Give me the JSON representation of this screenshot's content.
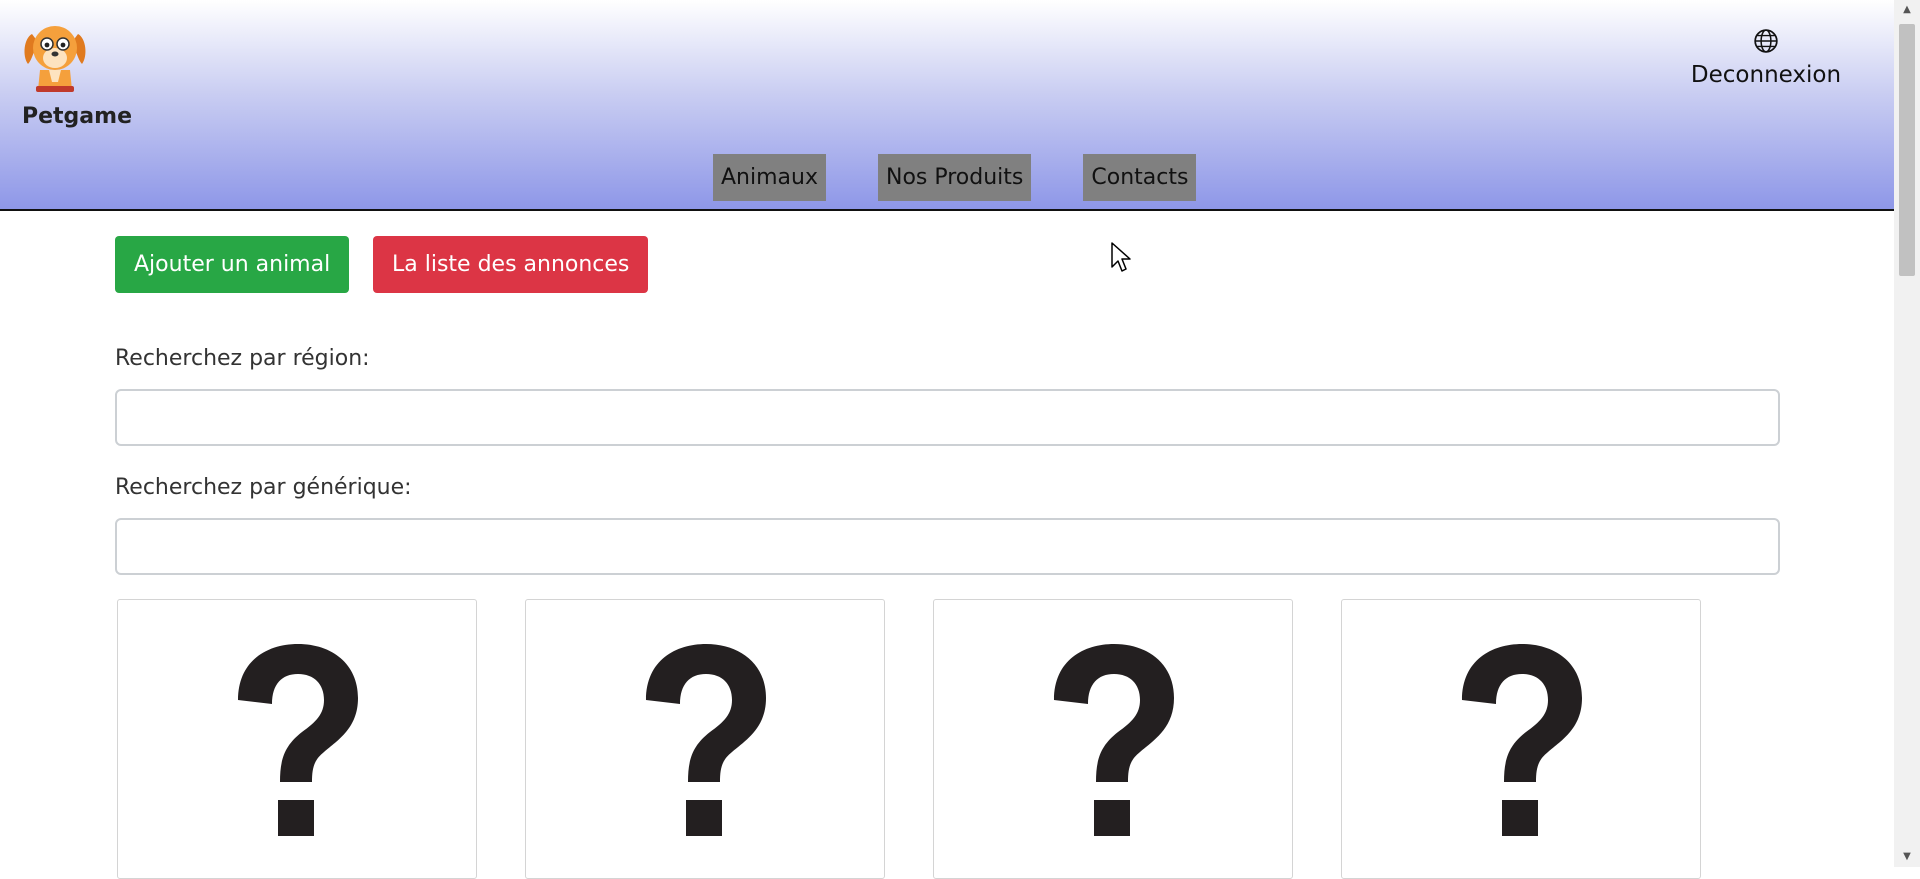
{
  "header": {
    "brand_name": "Petgame",
    "logout_label": "Deconnexion",
    "nav": [
      "Animaux",
      "Nos Produits",
      "Contacts"
    ]
  },
  "actions": {
    "add_animal": "Ajouter un animal",
    "ads_list": "La liste des annonces"
  },
  "search": {
    "region_label": "Recherchez par région:",
    "region_value": "",
    "generic_label": "Recherchez par générique:",
    "generic_value": ""
  },
  "cards": [
    {
      "image": "question-mark-placeholder"
    },
    {
      "image": "question-mark-placeholder"
    },
    {
      "image": "question-mark-placeholder"
    },
    {
      "image": "question-mark-placeholder"
    }
  ],
  "colors": {
    "header_top": "#ffffff",
    "header_bottom": "#8e97e8",
    "nav_bg": "#808080",
    "add_button": "#28a745",
    "list_button": "#dc3545"
  },
  "icons": {
    "brand_logo": "dog-logo-icon",
    "language": "globe-icon",
    "card_image": "question-mark-icon"
  }
}
